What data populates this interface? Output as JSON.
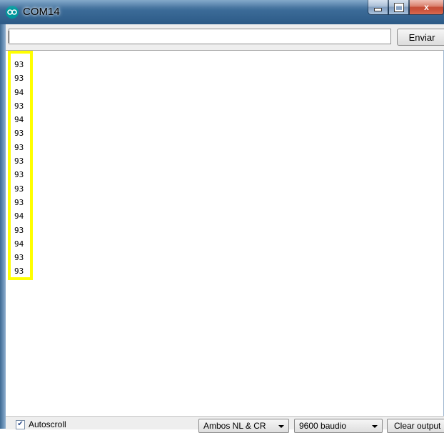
{
  "window": {
    "title": "COM14",
    "icon": "arduino-icon",
    "controls": {
      "minimize_icon": "minimize-icon",
      "maximize_icon": "maximize-icon",
      "close_icon": "close-icon",
      "close_glyph": "x"
    }
  },
  "send": {
    "input_value": "",
    "button_label": "Enviar"
  },
  "output": {
    "lines": [
      "93",
      "93",
      "94",
      "93",
      "94",
      "93",
      "93",
      "93",
      "93",
      "93",
      "93",
      "94",
      "93",
      "94",
      "93",
      "93"
    ],
    "highlight_color": "#ffff00"
  },
  "footer": {
    "autoscroll_label": "Autoscroll",
    "autoscroll_checked": true,
    "line_ending": "Ambos NL & CR",
    "baud_rate": "9600 baudio",
    "clear_label": "Clear output"
  }
}
